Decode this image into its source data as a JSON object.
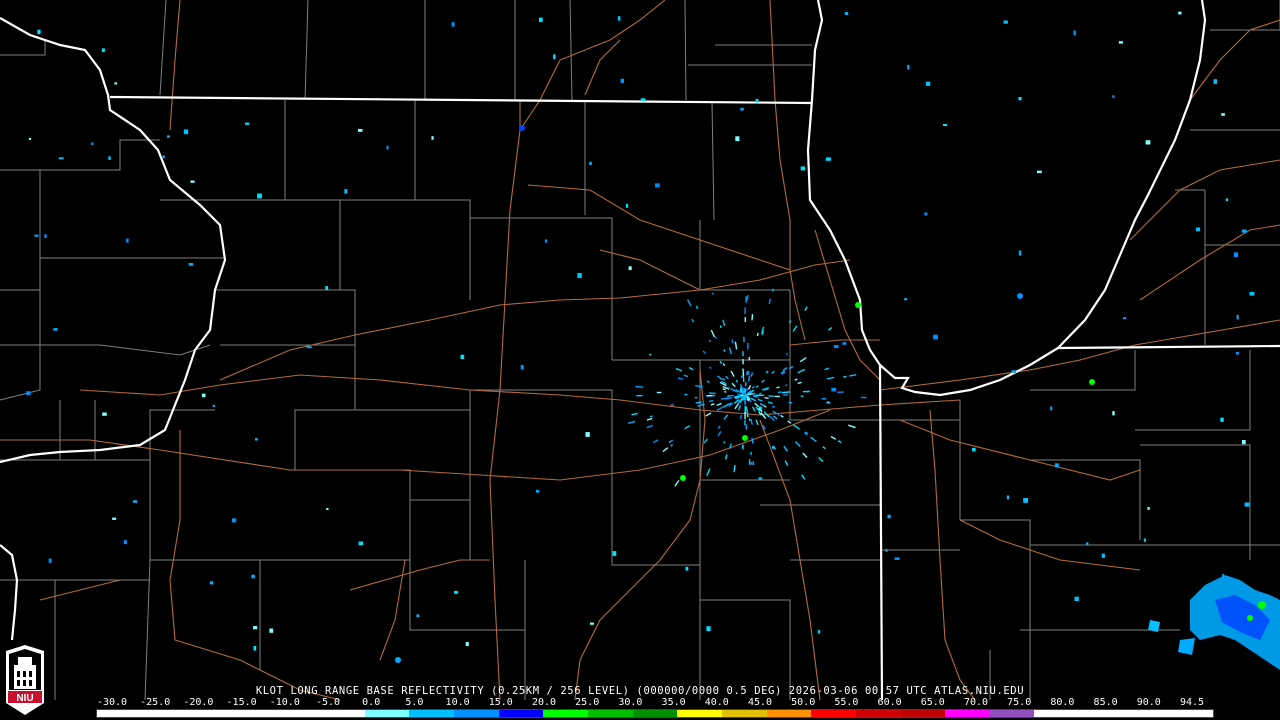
{
  "product": {
    "caption": "KLOT LONG RANGE BASE REFLECTIVITY (0.25KM / 256 LEVEL) (000000/0000 0.5 DEG) 2026-03-06 00:57 UTC  ATLAS.NIU.EDU",
    "radar_site": "KLOT",
    "timestamp": "2026-03-06 00:57 UTC",
    "source": "ATLAS.NIU.EDU"
  },
  "logo": {
    "text": "NIU",
    "icon": "niu-tower-logo"
  },
  "colors": {
    "background": "#000000",
    "state_border": "#ffffff",
    "county_line": "#7f7f7f",
    "highway": "#b56a3a"
  },
  "scale": {
    "labels": [
      "-30.0",
      "-25.0",
      "-20.0",
      "-15.0",
      "-10.0",
      "-5.0",
      "0.0",
      "5.0",
      "10.0",
      "15.0",
      "20.0",
      "25.0",
      "30.0",
      "35.0",
      "40.0",
      "45.0",
      "50.0",
      "55.0",
      "60.0",
      "65.0",
      "70.0",
      "75.0",
      "80.0",
      "85.0",
      "90.0",
      "94.5"
    ],
    "colors": [
      "#ffffff",
      "#ffffff",
      "#ffffff",
      "#ffffff",
      "#ffffff",
      "#ffffff",
      "#7fffff",
      "#00c0ff",
      "#0090ff",
      "#0000ff",
      "#00ff00",
      "#00c000",
      "#009000",
      "#ffff00",
      "#e0c000",
      "#ff9000",
      "#ff0000",
      "#d00000",
      "#c00000",
      "#ff00ff",
      "#9050c0",
      "#ffffff",
      "#ffffff",
      "#ffffff",
      "#ffffff"
    ]
  }
}
